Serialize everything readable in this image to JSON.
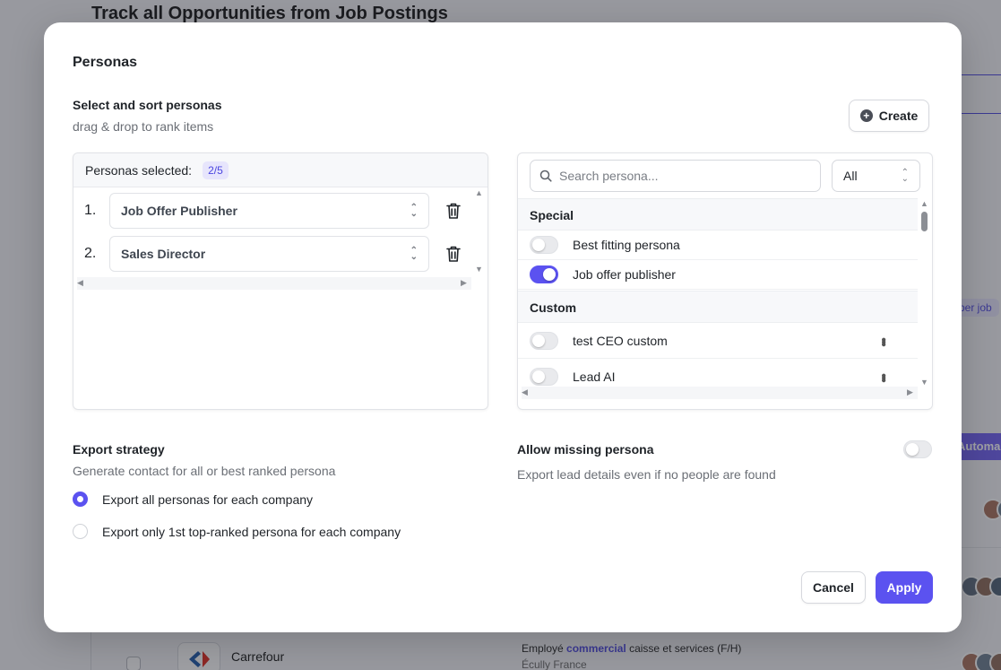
{
  "background": {
    "title": "Track all Opportunities from Job Postings",
    "pill": "ber job",
    "automate_btn": "Automa",
    "row": {
      "company": "Carrefour",
      "job_prefix": "Employé ",
      "job_highlight": "commercial",
      "job_suffix": " caisse et services (F/H)",
      "location": "Écully France"
    }
  },
  "modal": {
    "title": "Personas",
    "select_section": {
      "title": "Select and sort personas",
      "subtitle": "drag & drop to rank items"
    },
    "create_label": "Create",
    "selected_panel": {
      "label": "Personas selected:",
      "count": "2/5",
      "rows": [
        {
          "num": "1.",
          "value": "Job Offer Publisher"
        },
        {
          "num": "2.",
          "value": "Sales Director"
        }
      ]
    },
    "library_panel": {
      "search_placeholder": "Search persona...",
      "filter_value": "All",
      "groups": [
        {
          "name": "Special",
          "items": [
            {
              "label": "Best fitting persona",
              "enabled": false
            },
            {
              "label": "Job offer publisher",
              "enabled": true
            }
          ]
        },
        {
          "name": "Custom",
          "items": [
            {
              "label": "test CEO custom",
              "enabled": false
            },
            {
              "label": "Lead AI",
              "enabled": false
            }
          ]
        }
      ]
    },
    "export_strategy": {
      "title": "Export strategy",
      "subtitle": "Generate contact for all or best ranked persona",
      "options": [
        {
          "label": "Export all personas for each company",
          "checked": true
        },
        {
          "label": "Export only 1st top-ranked persona for each company",
          "checked": false
        }
      ]
    },
    "allow_missing": {
      "title": "Allow missing persona",
      "subtitle": "Export lead details even if no people are found",
      "enabled": false
    },
    "cancel_label": "Cancel",
    "apply_label": "Apply"
  },
  "colors": {
    "accent": "#5b52f0",
    "badge_bg": "#e7e5fc"
  }
}
